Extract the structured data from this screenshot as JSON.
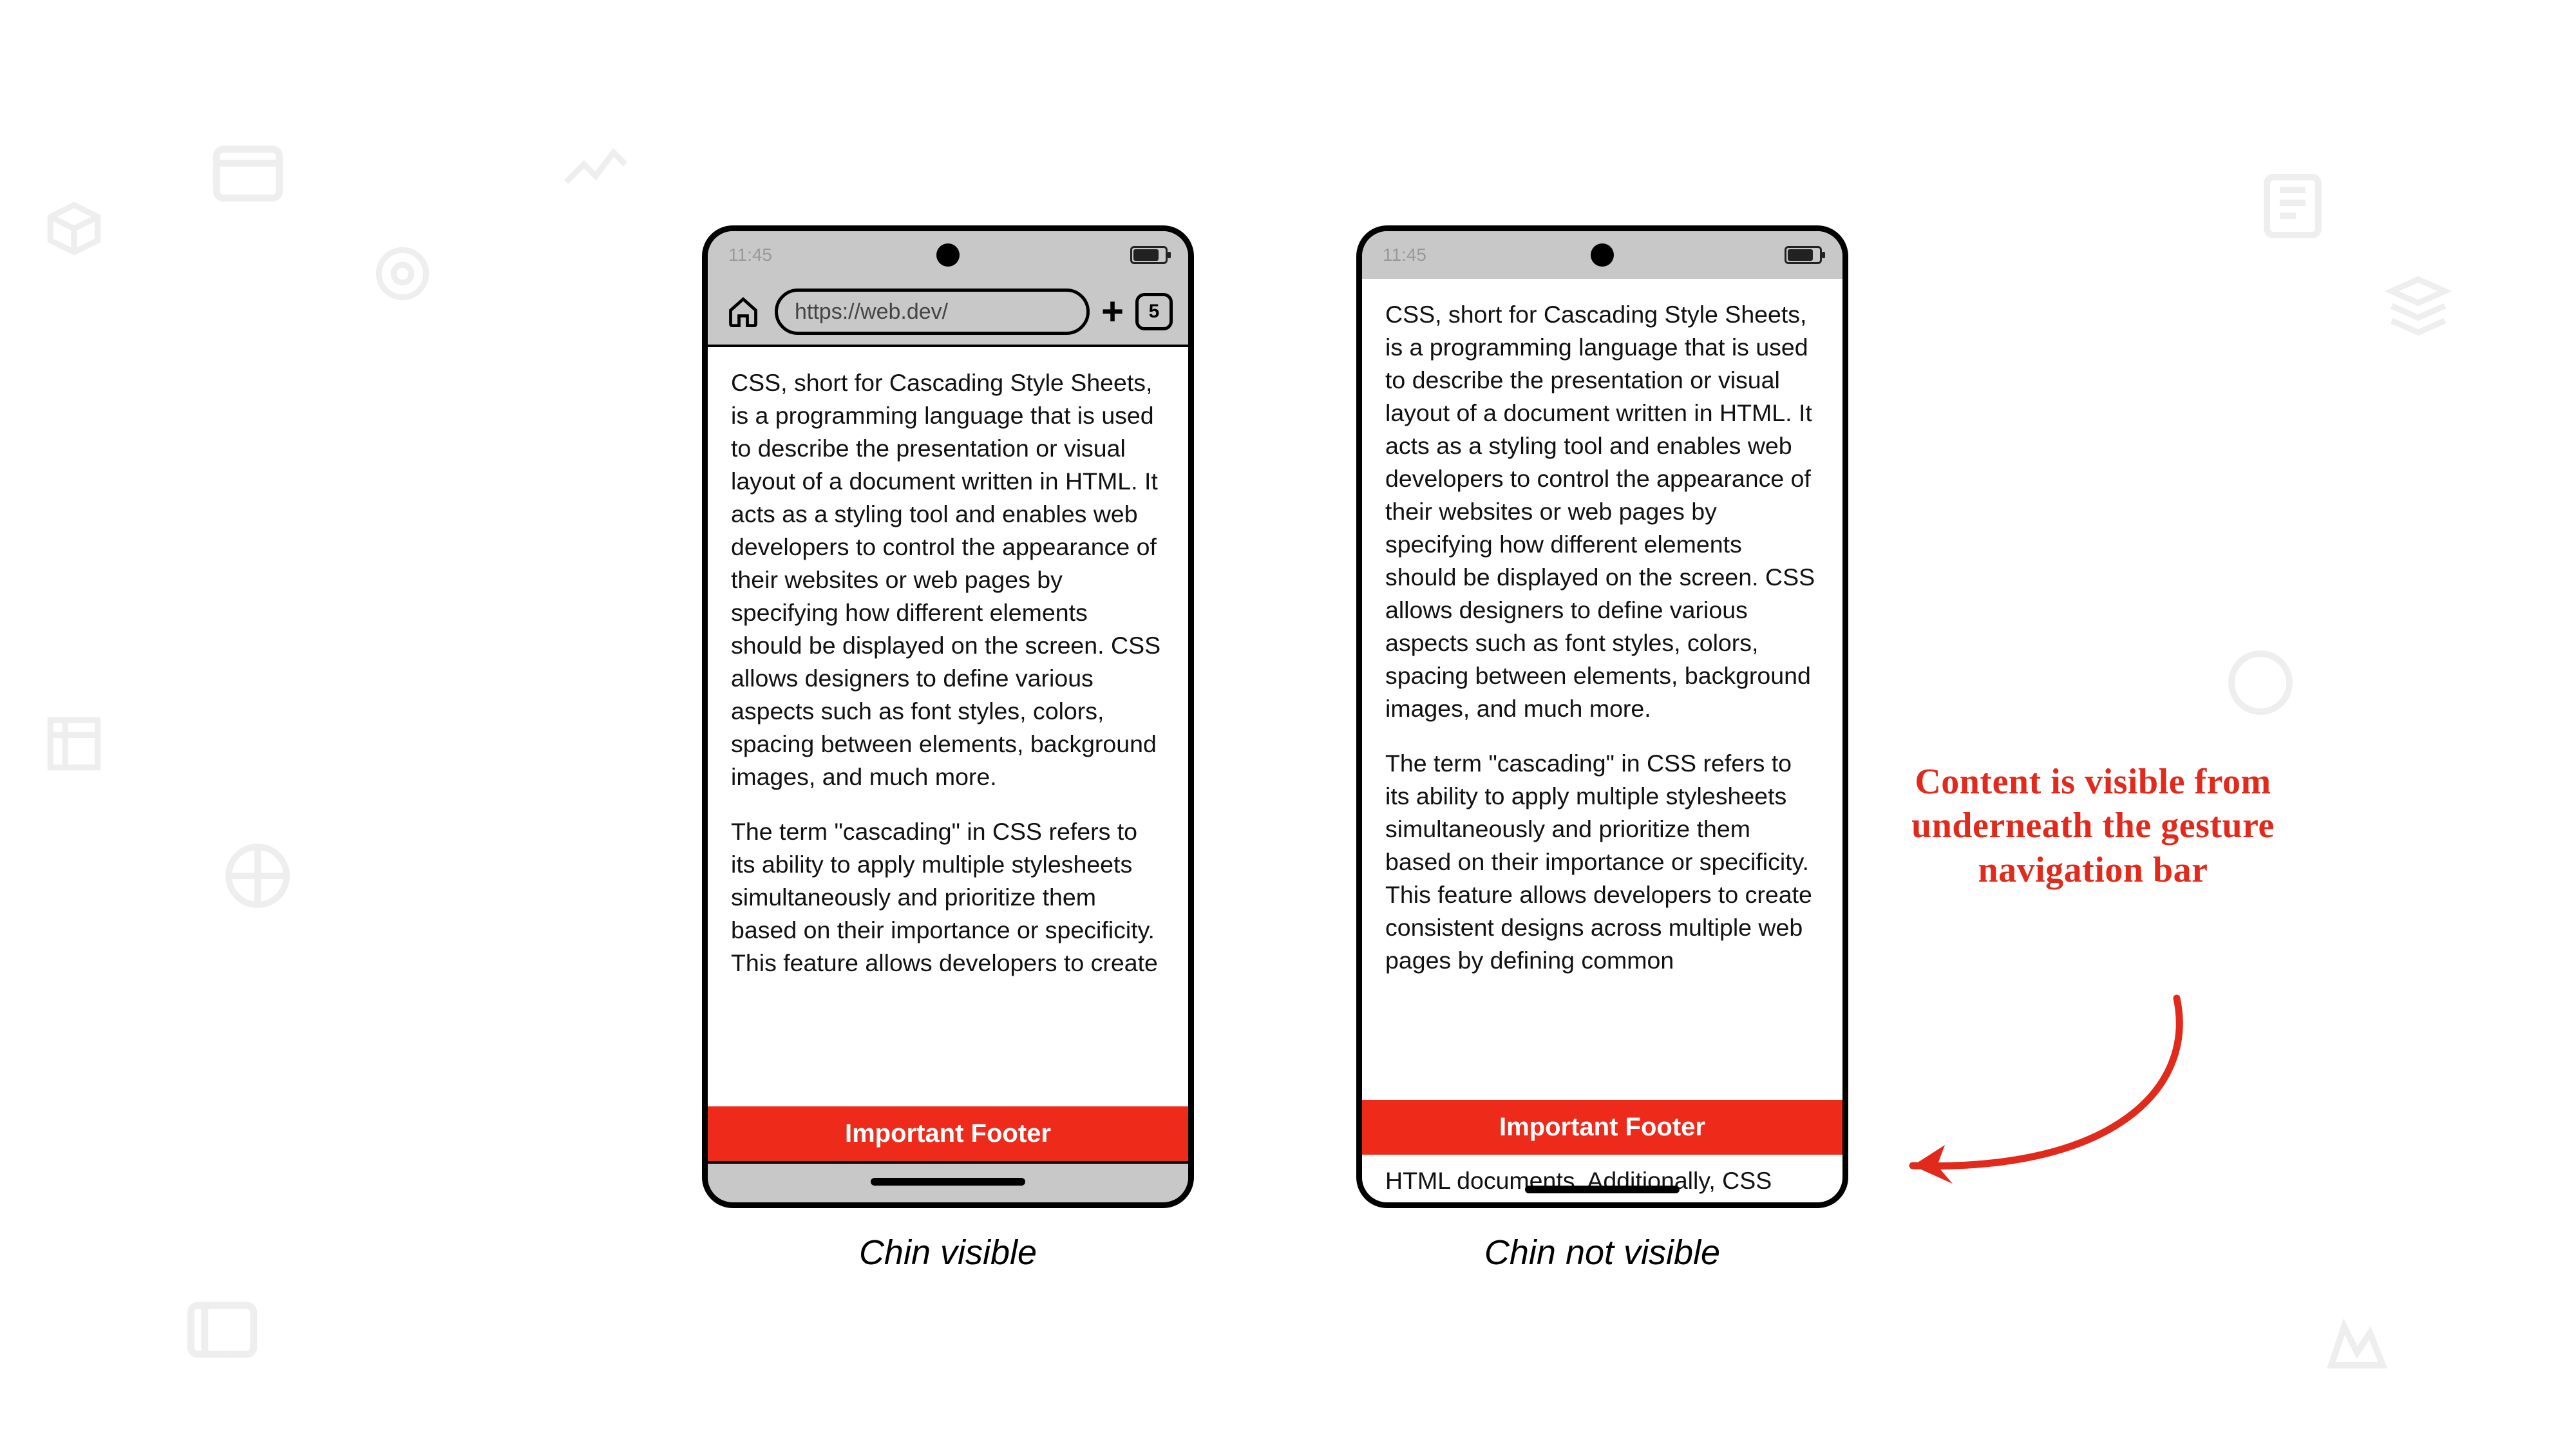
{
  "status": {
    "time": "11:45"
  },
  "browser": {
    "url": "https://web.dev/",
    "tab_count": "5"
  },
  "content": {
    "paragraph1": "CSS, short for Cascading Style Sheets, is a programming language that is used to describe the presentation or visual layout of a document written in HTML. It acts as a styling tool and enables web developers to control the appearance of their websites or web pages by specifying how different elements should be displayed on the screen. CSS allows designers to define various aspects such as font styles, colors, spacing between elements, background images, and much more.",
    "paragraph2_left": "The term \"cascading\" in CSS refers to its ability to apply multiple stylesheets simultaneously and prioritize them based on their importance or specificity. This feature allows developers to create",
    "paragraph2_right": "The term \"cascading\" in CSS refers to its ability to apply multiple stylesheets simultaneously and prioritize them based on their importance or specificity. This feature allows developers to create consistent designs across multiple web pages by defining common",
    "leak_line": "HTML documents. Additionally, CSS"
  },
  "footer": {
    "label": "Important Footer"
  },
  "captions": {
    "left": "Chin visible",
    "right": "Chin not visible"
  },
  "annotation": {
    "text": "Content is visible from underneath the gesture navigation bar"
  },
  "colors": {
    "accent": "#ee2a1b",
    "annotation": "#e1291c"
  }
}
